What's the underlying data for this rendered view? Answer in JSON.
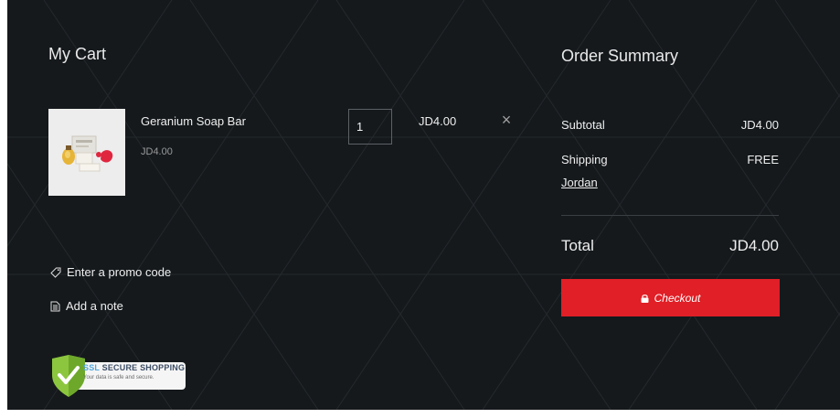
{
  "cart": {
    "title": "My Cart",
    "items": [
      {
        "name": "Geranium Soap Bar",
        "unit_price": "JD4.00",
        "quantity": "1",
        "line_total": "JD4.00",
        "remove_icon": "close-icon"
      }
    ],
    "promo_label": "Enter a promo code",
    "promo_icon": "tag-icon",
    "note_label": "Add a note",
    "note_icon": "note-icon"
  },
  "ssl_badge": {
    "title_prefix": "SSL",
    "title_rest": "SECURE SHOPPING",
    "subtitle": "Your data is safe and secure."
  },
  "summary": {
    "title": "Order Summary",
    "subtotal_label": "Subtotal",
    "subtotal_value": "JD4.00",
    "shipping_label": "Shipping",
    "shipping_value": "FREE",
    "shipping_destination": "Jordan",
    "total_label": "Total",
    "total_value": "JD4.00",
    "checkout_label": "Checkout",
    "checkout_icon": "lock-icon"
  },
  "colors": {
    "background": "#15191c",
    "accent": "#e01f26",
    "text": "#eeeeee",
    "muted": "#9a9a9a"
  }
}
